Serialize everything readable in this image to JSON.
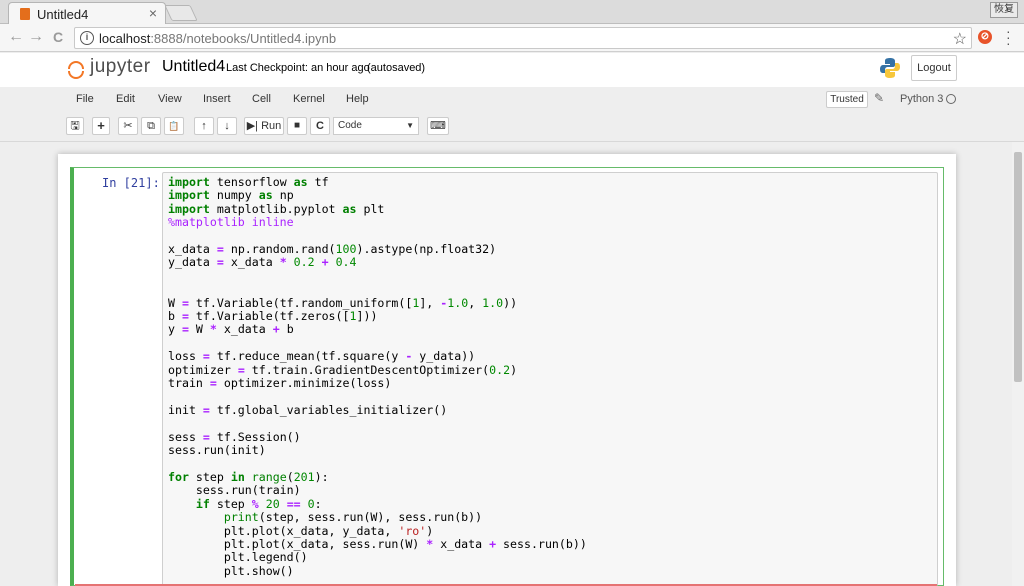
{
  "browser": {
    "tab_title": "Untitled4",
    "tab_close": "×",
    "window_control": "恢复",
    "url_host": "localhost",
    "url_rest": ":8888/notebooks/Untitled4.ipynb",
    "back_icon": "←",
    "forward_icon": "→",
    "reload_icon": "C",
    "star_icon": "☆"
  },
  "header": {
    "logo_text": "jupyter",
    "notebook_name": "Untitled4",
    "checkpoint": "Last Checkpoint: an hour ago",
    "autosaved": "(autosaved)",
    "logout_label": "Logout"
  },
  "menubar": {
    "items": [
      "File",
      "Edit",
      "View",
      "Insert",
      "Cell",
      "Kernel",
      "Help"
    ],
    "trusted_label": "Trusted",
    "kernel_name": "Python 3"
  },
  "toolbar": {
    "save_icon": "🖫",
    "add_icon": "+",
    "cut_icon": "✂",
    "copy_icon": "⧉",
    "paste_icon": "📋",
    "up_icon": "↑",
    "down_icon": "↓",
    "run_label": "▶| Run",
    "stop_icon": "■",
    "restart_icon": "C",
    "cell_type": "Code",
    "keyboard_icon": "⌨"
  },
  "cell": {
    "prompt": "In [21]:",
    "source": [
      "import tensorflow as tf",
      "import numpy as np",
      "import matplotlib.pyplot as plt",
      "%matplotlib inline",
      "",
      "x_data = np.random.rand(100).astype(np.float32)",
      "y_data = x_data * 0.2 + 0.4",
      "",
      "",
      "W = tf.Variable(tf.random_uniform([1], -1.0, 1.0))",
      "b = tf.Variable(tf.zeros([1]))",
      "y = W * x_data + b",
      "",
      "loss = tf.reduce_mean(tf.square(y - y_data))",
      "optimizer = tf.train.GradientDescentOptimizer(0.2)",
      "train = optimizer.minimize(loss)",
      "",
      "init = tf.global_variables_initializer()",
      "",
      "sess = tf.Session()",
      "sess.run(init)",
      "",
      "for step in range(201):",
      "    sess.run(train)",
      "    if step % 20 == 0:",
      "        print(step, sess.run(W), sess.run(b))",
      "        plt.plot(x_data, y_data, 'ro')",
      "        plt.plot(x_data, sess.run(W) * x_data + sess.run(b))",
      "        plt.legend()",
      "        plt.show()"
    ]
  }
}
